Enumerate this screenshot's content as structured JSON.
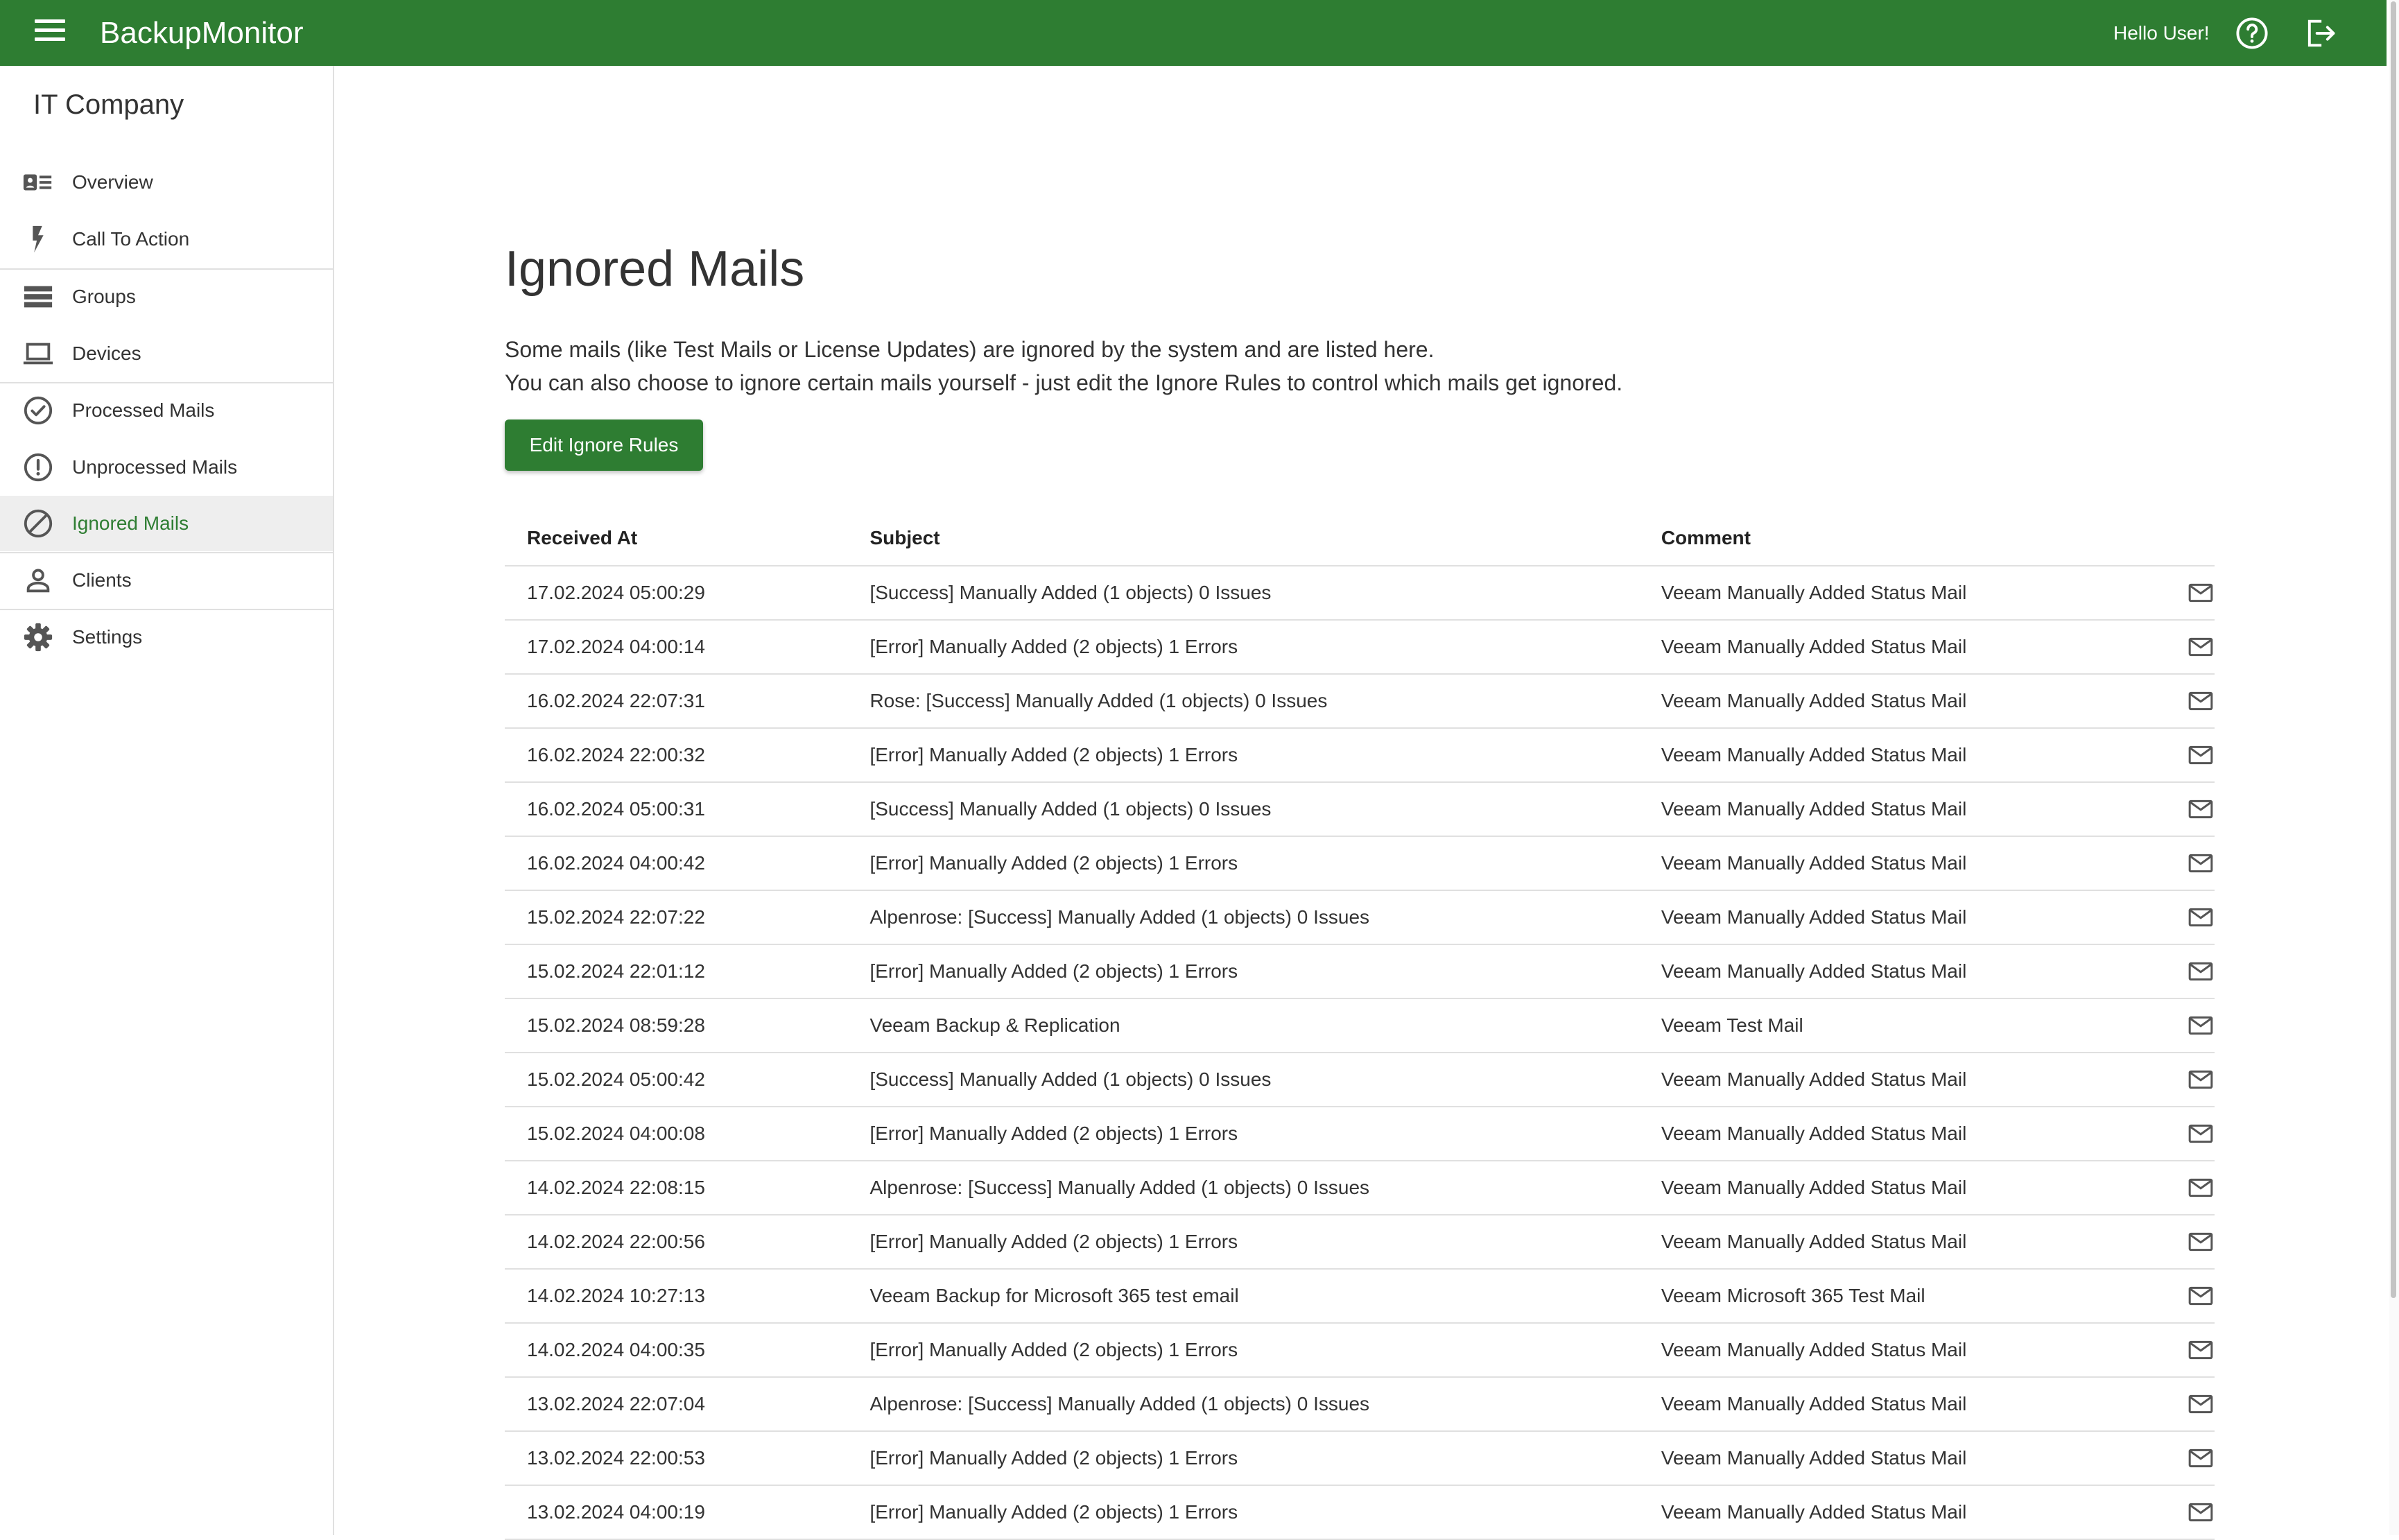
{
  "app": {
    "title": "BackupMonitor",
    "greeting": "Hello User!"
  },
  "icons": {
    "menu": "menu-icon",
    "help": "help-circle-icon",
    "logout": "logout-icon",
    "mail": "mail-icon"
  },
  "colors": {
    "primary": "#2e7d32",
    "active_bg": "#eeeeee"
  },
  "sidebar": {
    "company": "IT Company",
    "items": [
      {
        "label": "Overview",
        "icon": "overview-card-icon"
      },
      {
        "label": "Call To Action",
        "icon": "lightning-bolt-icon"
      },
      {
        "label": "Groups",
        "icon": "groups-list-icon"
      },
      {
        "label": "Devices",
        "icon": "laptop-icon"
      },
      {
        "label": "Processed Mails",
        "icon": "check-circle-icon"
      },
      {
        "label": "Unprocessed Mails",
        "icon": "alert-circle-icon"
      },
      {
        "label": "Ignored Mails",
        "icon": "block-icon",
        "active": true
      },
      {
        "label": "Clients",
        "icon": "person-icon"
      },
      {
        "label": "Settings",
        "icon": "gear-icon"
      }
    ]
  },
  "main": {
    "title": "Ignored Mails",
    "description_line1": "Some mails (like Test Mails or License Updates) are ignored by the system and are listed here.",
    "description_line2": "You can also choose to ignore certain mails yourself - just edit the Ignore Rules to control which mails get ignored.",
    "edit_button": "Edit Ignore Rules",
    "table": {
      "headers": {
        "received_at": "Received At",
        "subject": "Subject",
        "comment": "Comment"
      },
      "rows": [
        {
          "received_at": "17.02.2024 05:00:29",
          "subject": "[Success] Manually Added (1 objects) 0 Issues",
          "comment": "Veeam Manually Added Status Mail"
        },
        {
          "received_at": "17.02.2024 04:00:14",
          "subject": "[Error] Manually Added (2 objects) 1 Errors",
          "comment": "Veeam Manually Added Status Mail"
        },
        {
          "received_at": "16.02.2024 22:07:31",
          "subject": "Rose: [Success] Manually Added (1 objects) 0 Issues",
          "comment": "Veeam Manually Added Status Mail"
        },
        {
          "received_at": "16.02.2024 22:00:32",
          "subject": "[Error] Manually Added (2 objects) 1 Errors",
          "comment": "Veeam Manually Added Status Mail"
        },
        {
          "received_at": "16.02.2024 05:00:31",
          "subject": "[Success] Manually Added (1 objects) 0 Issues",
          "comment": "Veeam Manually Added Status Mail"
        },
        {
          "received_at": "16.02.2024 04:00:42",
          "subject": "[Error] Manually Added (2 objects) 1 Errors",
          "comment": "Veeam Manually Added Status Mail"
        },
        {
          "received_at": "15.02.2024 22:07:22",
          "subject": "Alpenrose: [Success] Manually Added (1 objects) 0 Issues",
          "comment": "Veeam Manually Added Status Mail"
        },
        {
          "received_at": "15.02.2024 22:01:12",
          "subject": "[Error] Manually Added (2 objects) 1 Errors",
          "comment": "Veeam Manually Added Status Mail"
        },
        {
          "received_at": "15.02.2024 08:59:28",
          "subject": "Veeam Backup & Replication",
          "comment": "Veeam Test Mail"
        },
        {
          "received_at": "15.02.2024 05:00:42",
          "subject": "[Success] Manually Added (1 objects) 0 Issues",
          "comment": "Veeam Manually Added Status Mail"
        },
        {
          "received_at": "15.02.2024 04:00:08",
          "subject": "[Error] Manually Added (2 objects) 1 Errors",
          "comment": "Veeam Manually Added Status Mail"
        },
        {
          "received_at": "14.02.2024 22:08:15",
          "subject": "Alpenrose: [Success] Manually Added (1 objects) 0 Issues",
          "comment": "Veeam Manually Added Status Mail"
        },
        {
          "received_at": "14.02.2024 22:00:56",
          "subject": "[Error] Manually Added (2 objects) 1 Errors",
          "comment": "Veeam Manually Added Status Mail"
        },
        {
          "received_at": "14.02.2024 10:27:13",
          "subject": "Veeam Backup for Microsoft 365 test email",
          "comment": "Veeam Microsoft 365 Test Mail"
        },
        {
          "received_at": "14.02.2024 04:00:35",
          "subject": "[Error] Manually Added (2 objects) 1 Errors",
          "comment": "Veeam Manually Added Status Mail"
        },
        {
          "received_at": "13.02.2024 22:07:04",
          "subject": "Alpenrose: [Success] Manually Added (1 objects) 0 Issues",
          "comment": "Veeam Manually Added Status Mail"
        },
        {
          "received_at": "13.02.2024 22:00:53",
          "subject": "[Error] Manually Added (2 objects) 1 Errors",
          "comment": "Veeam Manually Added Status Mail"
        },
        {
          "received_at": "13.02.2024 04:00:19",
          "subject": "[Error] Manually Added (2 objects) 1 Errors",
          "comment": "Veeam Manually Added Status Mail"
        }
      ]
    }
  }
}
